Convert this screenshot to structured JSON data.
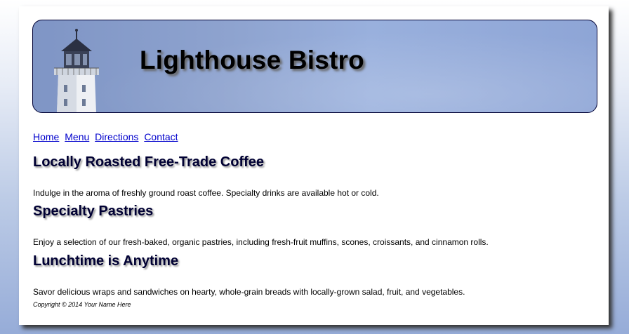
{
  "header": {
    "title": "Lighthouse Bistro"
  },
  "nav": {
    "items": [
      {
        "label": "Home"
      },
      {
        "label": "Menu"
      },
      {
        "label": "Directions"
      },
      {
        "label": "Contact"
      }
    ]
  },
  "sections": [
    {
      "heading": "Locally Roasted Free-Trade Coffee",
      "text": "Indulge in the aroma of freshly ground roast coffee. Specialty drinks are available hot or cold."
    },
    {
      "heading": "Specialty Pastries",
      "text": "Enjoy a selection of our fresh-baked, organic pastries, including fresh-fruit muffins, scones, croissants, and cinnamon rolls."
    },
    {
      "heading": "Lunchtime is Anytime",
      "text": "Savor delicious wraps and sandwiches on hearty, whole-grain breads with locally-grown salad, fruit, and vegetables."
    }
  ],
  "footer": {
    "copyright": "Copyright © 2014 Your Name Here"
  },
  "colors": {
    "header_bg": "#8ea3cf",
    "heading": "#000033",
    "link": "#0000cc"
  }
}
